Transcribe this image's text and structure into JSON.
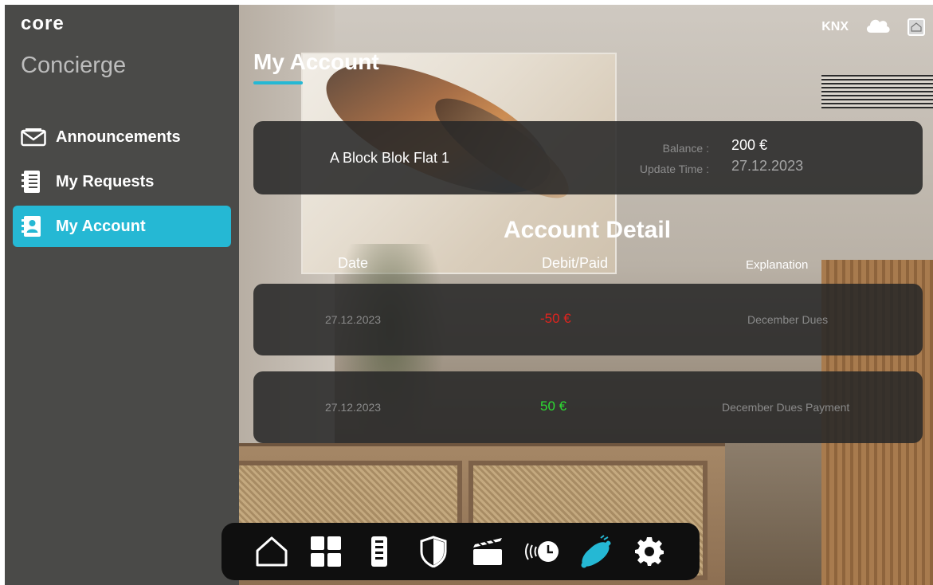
{
  "app": {
    "brand": "core",
    "section": "Concierge",
    "accent_color": "#25b8d4"
  },
  "sidebar": {
    "items": [
      {
        "label": "Announcements",
        "icon": "envelope-icon",
        "active": false
      },
      {
        "label": "My Requests",
        "icon": "list-icon",
        "active": false
      },
      {
        "label": "My Account",
        "icon": "account-book-icon",
        "active": true
      }
    ]
  },
  "header": {
    "protocol": "KNX",
    "cloud_icon": "cloud-icon",
    "home_icon": "home-box-icon"
  },
  "page": {
    "title": "My Account"
  },
  "balance": {
    "unit_name": "A Block Blok Flat 1",
    "balance_label": "Balance :",
    "balance_value": "200 €",
    "update_label": "Update Time :",
    "update_value": "27.12.2023"
  },
  "detail": {
    "title": "Account Detail",
    "columns": [
      "Date",
      "Debit/Paid",
      "Explanation"
    ],
    "rows": [
      {
        "date": "27.12.2023",
        "amount": "-50 €",
        "type": "debit",
        "explanation": "December Dues"
      },
      {
        "date": "27.12.2023",
        "amount": "50 €",
        "type": "paid",
        "explanation": "December Dues Payment"
      }
    ],
    "debit_color": "#e0231e",
    "paid_color": "#2ddd32"
  },
  "dock": {
    "items": [
      "home-icon",
      "grid-icon",
      "remote-icon",
      "shield-icon",
      "clapperboard-icon",
      "schedule-icon",
      "concierge-bell-icon",
      "settings-gear-icon"
    ],
    "active": "concierge-bell-icon"
  }
}
